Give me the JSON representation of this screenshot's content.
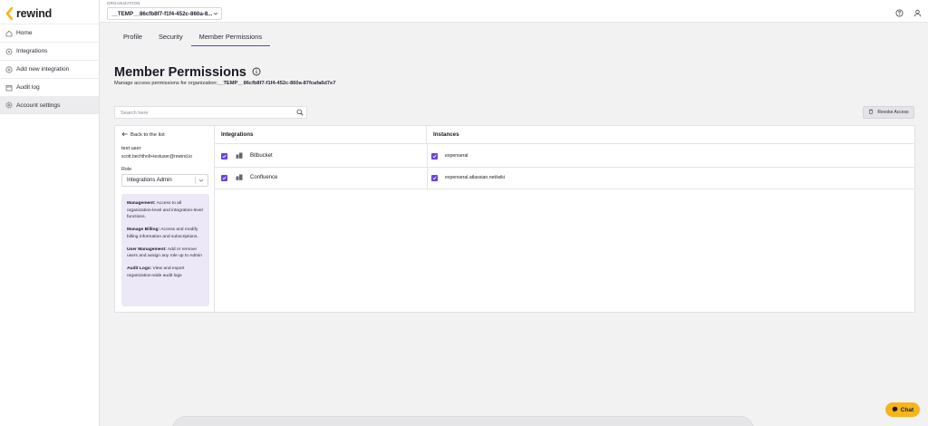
{
  "brand": {
    "name": "rewind",
    "accent": "#f5b61c",
    "primary": "#6a46d6"
  },
  "sidebar": {
    "items": [
      {
        "label": "Home",
        "icon": "home-icon"
      },
      {
        "label": "Integrations",
        "icon": "integrations-icon"
      },
      {
        "label": "Add new integration",
        "icon": "plus-circle-icon"
      },
      {
        "label": "Audit log",
        "icon": "calendar-icon"
      },
      {
        "label": "Account settings",
        "icon": "gear-icon",
        "active": true
      }
    ]
  },
  "topbar": {
    "org_caption": "ORGANIZATION",
    "org_value": "__TEMP__86cfb8f7-f1f4-452c-860a-8...",
    "help_icon": "help-icon",
    "user_icon": "user-icon"
  },
  "tabs": [
    {
      "label": "Profile"
    },
    {
      "label": "Security"
    },
    {
      "label": "Member Permissions",
      "active": true
    }
  ],
  "page": {
    "title": "Member Permissions",
    "subtitle_prefix": "Manage access permissions for organization:",
    "subtitle_org": "__TEMP__86cfb8f7-f1f4-452c-860a-87fcafa6d7e7"
  },
  "search": {
    "placeholder": "Search here"
  },
  "revoke": {
    "label": "Revoke Access"
  },
  "member": {
    "back_label": "Back to the list",
    "name": "test user",
    "email": "scott.bechtholt+testuser@rewind.io",
    "role_label": "Role",
    "role_value": "Integrations Admin",
    "permissions": [
      {
        "title": "Management:",
        "text": "Access to all organization-level and integration-level functions."
      },
      {
        "title": "Manage Billing:",
        "text": "Access and modify billing information and subscriptions."
      },
      {
        "title": "User Management:",
        "text": "Add or remove users and assign any role up to Admin"
      },
      {
        "title": "Audit Logs:",
        "text": "View and export organization-wide audit logs"
      }
    ]
  },
  "table": {
    "headers": {
      "integrations": "Integrations",
      "instances": "Instances"
    },
    "rows": [
      {
        "integration": "Bitbucket",
        "instance": "expenseral",
        "checked": true
      },
      {
        "integration": "Confluence",
        "instance": "expenseral.atlassian.net/wiki",
        "checked": true
      }
    ]
  },
  "chat": {
    "label": "Chat"
  }
}
